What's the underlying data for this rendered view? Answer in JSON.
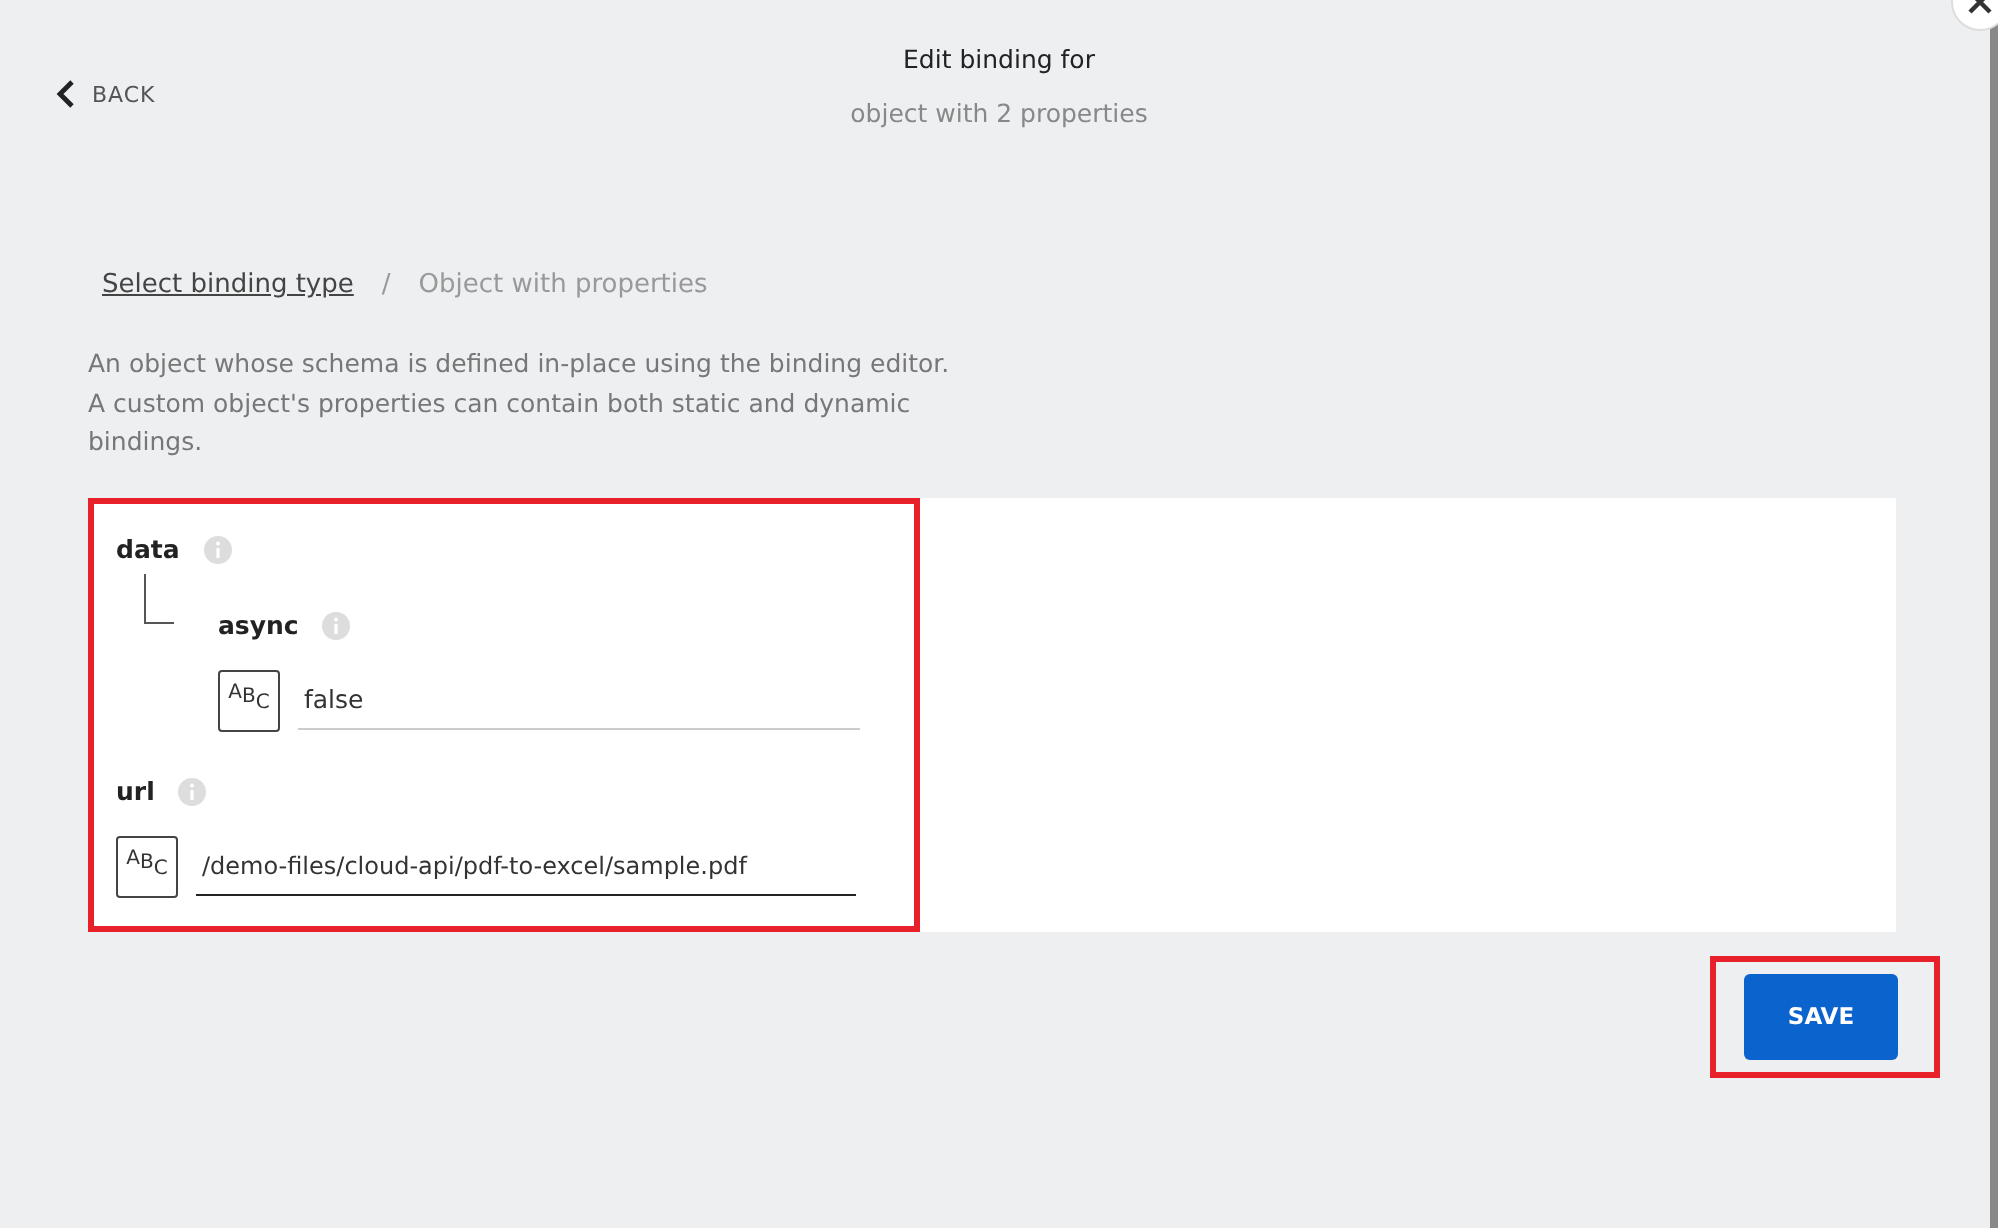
{
  "header": {
    "back": "BACK",
    "title": "Edit binding for",
    "subtitle": "object with 2 properties"
  },
  "breadcrumb": {
    "link": "Select binding type",
    "separator": "/",
    "current": "Object with properties"
  },
  "description": [
    "An object whose schema is defined in-place using the binding editor.",
    "A custom object's properties can contain both static and dynamic",
    "bindings."
  ],
  "editor": {
    "highlighted": true,
    "properties": [
      {
        "name": "data",
        "children": [
          {
            "name": "async",
            "type_glyphs": "ABC",
            "value": "false",
            "focused": false
          }
        ]
      },
      {
        "name": "url",
        "type_glyphs": "ABC",
        "value": "/demo-files/cloud-api/pdf-to-excel/sample.pdf",
        "focused": true
      }
    ]
  },
  "save": {
    "label": "SAVE",
    "highlighted": true
  }
}
